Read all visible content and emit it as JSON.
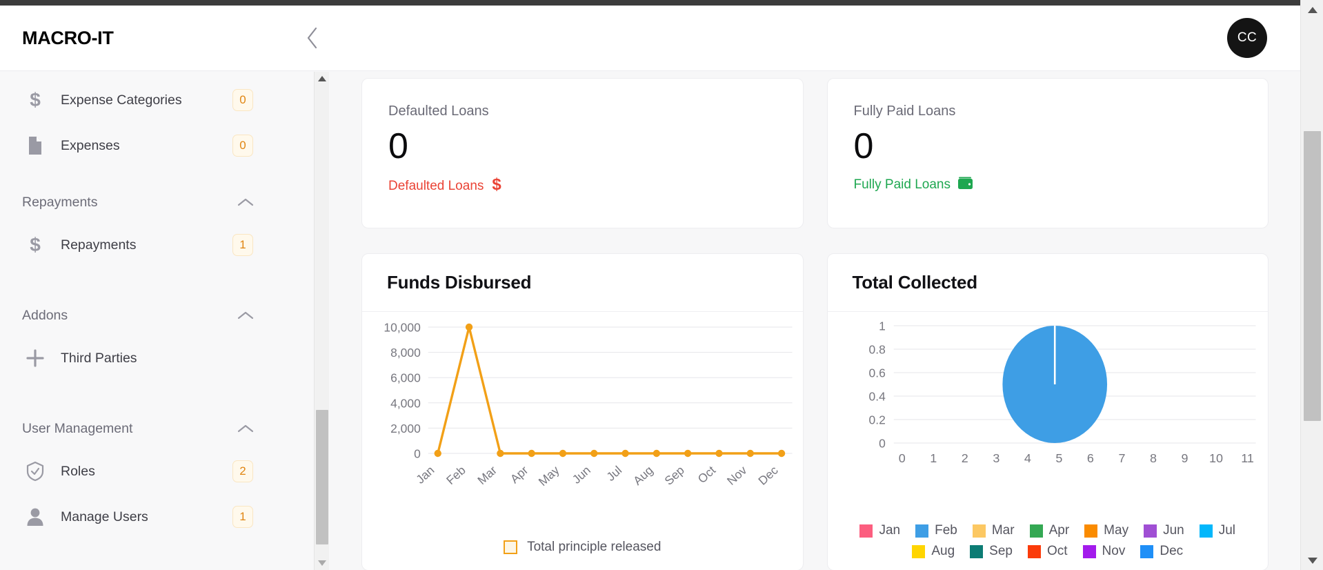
{
  "app": {
    "brand": "MACRO-IT",
    "avatar_initials": "CC",
    "collapse_icon": "chevron-left-icon"
  },
  "sidebar": {
    "items": [
      {
        "type": "item",
        "label": "Expense Categories",
        "badge": "0",
        "icon": "dollar-icon"
      },
      {
        "type": "item",
        "label": "Expenses",
        "badge": "0",
        "icon": "document-icon"
      },
      {
        "type": "group",
        "label": "Repayments",
        "icon": "chevron-up-icon"
      },
      {
        "type": "item",
        "label": "Repayments",
        "badge": "1",
        "icon": "dollar-icon"
      },
      {
        "type": "group",
        "label": "Addons",
        "icon": "chevron-up-icon"
      },
      {
        "type": "item",
        "label": "Third Parties",
        "badge": "",
        "icon": "plus-icon"
      },
      {
        "type": "group",
        "label": "User Management",
        "icon": "chevron-up-icon"
      },
      {
        "type": "item",
        "label": "Roles",
        "badge": "2",
        "icon": "shield-check-icon"
      },
      {
        "type": "item",
        "label": "Manage Users",
        "badge": "1",
        "icon": "user-icon"
      }
    ]
  },
  "stats": [
    {
      "title": "Defaulted Loans",
      "value": "0",
      "foot_label": "Defaulted Loans",
      "foot_icon": "dollar-icon",
      "accent": "#ea4335"
    },
    {
      "title": "Fully Paid Loans",
      "value": "0",
      "foot_label": "Fully Paid Loans",
      "foot_icon": "wallet-icon",
      "accent": "#1ea750"
    }
  ],
  "charts": {
    "funds": {
      "title": "Funds Disbursed"
    },
    "collected": {
      "title": "Total Collected"
    }
  },
  "chart_data": [
    {
      "type": "line",
      "title": "Funds Disbursed",
      "categories": [
        "Jan",
        "Feb",
        "Mar",
        "Apr",
        "May",
        "Jun",
        "Jul",
        "Aug",
        "Sep",
        "Oct",
        "Nov",
        "Dec"
      ],
      "series": [
        {
          "name": "Total principle released",
          "values": [
            0,
            10000,
            0,
            0,
            0,
            0,
            0,
            0,
            0,
            0,
            0,
            0
          ],
          "color": "#f2a017"
        }
      ],
      "ylabel": "",
      "xlabel": "",
      "ylim": [
        0,
        10000
      ],
      "yticks": [
        "0",
        "2,000",
        "4,000",
        "6,000",
        "8,000",
        "10,000"
      ],
      "grid": true,
      "legend": [
        "Total principle released"
      ],
      "legend_position": "bottom"
    },
    {
      "type": "pie",
      "title": "Total Collected",
      "labels": [
        "Jan",
        "Feb",
        "Mar",
        "Apr",
        "May",
        "Jun",
        "Jul",
        "Aug",
        "Sep",
        "Oct",
        "Nov",
        "Dec"
      ],
      "values": [
        0,
        1,
        0,
        0,
        0,
        0,
        0,
        0,
        0,
        0,
        0,
        0
      ],
      "colors": [
        "#fc5e7f",
        "#3e9ee5",
        "#fcc863",
        "#34a853",
        "#fa8b00",
        "#a04fd4",
        "#03b7fb",
        "#ffd500",
        "#0c7c74",
        "#fb3b0a",
        "#a31bec",
        "#1f8ff7"
      ],
      "xticks": [
        "0",
        "1",
        "2",
        "3",
        "4",
        "5",
        "6",
        "7",
        "8",
        "9",
        "10",
        "11"
      ],
      "yticks": [
        "0",
        "0.2",
        "0.4",
        "0.6",
        "0.8",
        "1"
      ],
      "ylim": [
        0,
        1
      ],
      "xlim": [
        0,
        11
      ],
      "grid": true,
      "legend_position": "bottom"
    }
  ]
}
